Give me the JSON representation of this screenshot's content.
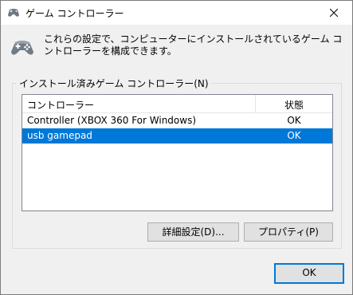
{
  "window": {
    "title": "ゲーム コントローラー",
    "icon": "gamepad-icon",
    "close_icon": "close-icon"
  },
  "header": {
    "icon": "gamepad-icon",
    "description": "これらの設定で、コンピューターにインストールされているゲーム コントローラーを構成できます。"
  },
  "group": {
    "label": "インストール済みゲーム コントローラー(N)"
  },
  "list": {
    "columns": {
      "name": "コントローラー",
      "status": "状態"
    },
    "rows": [
      {
        "name": "Controller (XBOX 360 For Windows)",
        "status": "OK"
      },
      {
        "name": "usb gamepad",
        "status": "OK"
      }
    ],
    "selected_index": 1
  },
  "buttons": {
    "advanced": "詳細設定(D)...",
    "properties": "プロパティ(P)",
    "ok": "OK"
  },
  "colors": {
    "selection": "#0078d7",
    "window_bg": "#f0f0f0",
    "button_bg": "#e1e1e1"
  }
}
